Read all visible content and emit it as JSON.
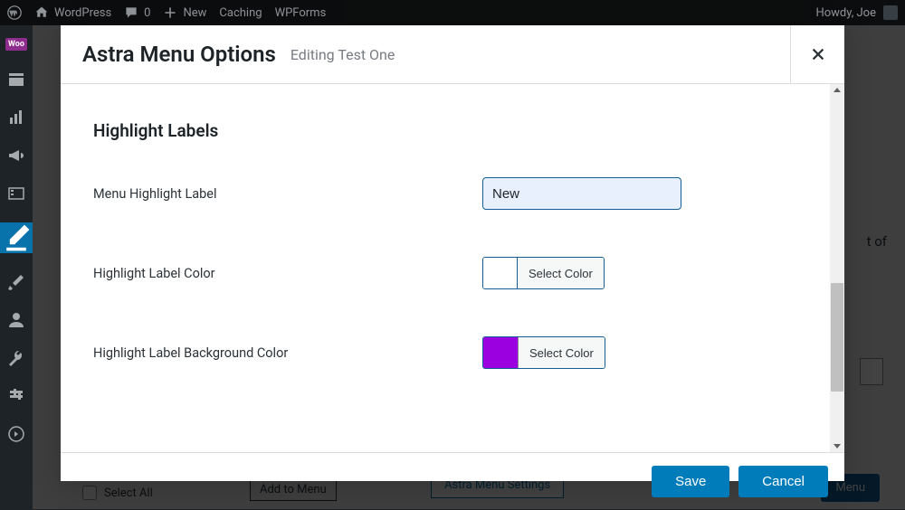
{
  "admin_bar": {
    "site_name": "WordPress",
    "comments_count": "0",
    "new_label": "New",
    "caching_label": "Caching",
    "wpforms_label": "WPForms",
    "howdy": "Howdy, Joe"
  },
  "sidebar": {
    "woo_label": "Woo"
  },
  "background": {
    "right_of": "t of",
    "select_all": "Select All",
    "add_to_menu": "Add to Menu",
    "astra_menu_settings": "Astra Menu Settings",
    "save_menu": "Menu"
  },
  "modal": {
    "title": "Astra Menu Options",
    "subtitle": "Editing Test One",
    "section_title": "Highlight Labels",
    "fields": {
      "menu_highlight_label": {
        "label": "Menu Highlight Label",
        "value": "New"
      },
      "highlight_label_color": {
        "label": "Highlight Label Color",
        "button": "Select Color",
        "swatch": "#ffffff"
      },
      "highlight_label_bg_color": {
        "label": "Highlight Label Background Color",
        "button": "Select Color",
        "swatch": "#9b00e0"
      }
    },
    "buttons": {
      "save": "Save",
      "cancel": "Cancel"
    }
  }
}
